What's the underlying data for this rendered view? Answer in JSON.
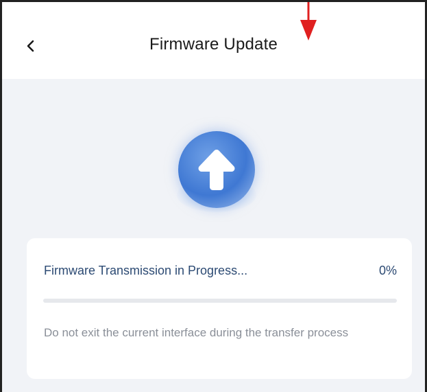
{
  "header": {
    "title": "Firmware Update",
    "back_icon": "chevron-left-icon"
  },
  "upload": {
    "icon": "upload-arrow-icon",
    "accent_color": "#3f78d3"
  },
  "progress": {
    "status": "Firmware Transmission in Progress...",
    "percent_label": "0%",
    "value": 0,
    "note": "Do not exit the current interface during the transfer process"
  },
  "annotation": {
    "icon": "red-down-arrow-icon",
    "color": "#e02020"
  }
}
